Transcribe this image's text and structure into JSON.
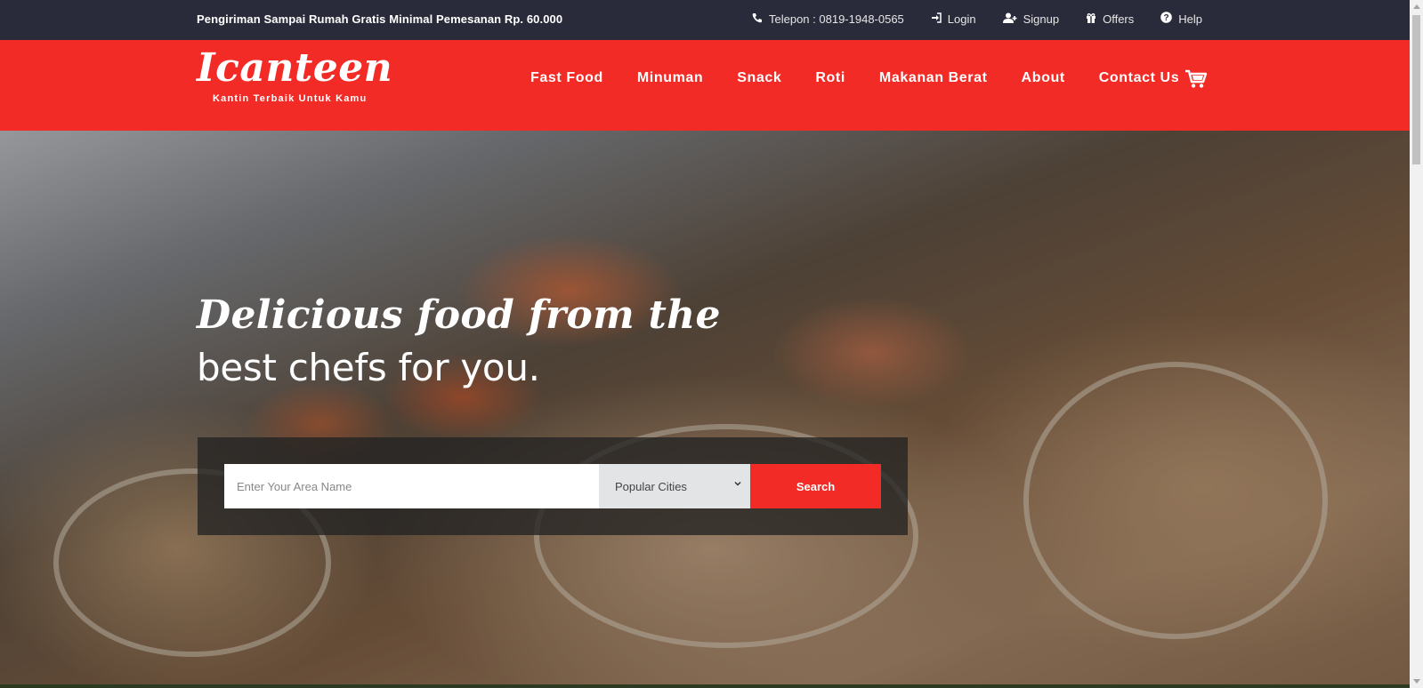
{
  "topbar": {
    "promo": "Pengiriman Sampai Rumah Gratis Minimal Pemesanan Rp. 60.000",
    "links": [
      {
        "label": "Telepon : 0819-1948-0565",
        "icon": "phone-icon"
      },
      {
        "label": "Login",
        "icon": "sign-in-icon"
      },
      {
        "label": "Signup",
        "icon": "user-plus-icon"
      },
      {
        "label": "Offers",
        "icon": "gift-icon"
      },
      {
        "label": "Help",
        "icon": "question-circle-icon"
      }
    ]
  },
  "header": {
    "logo_name": "Icanteen",
    "logo_tagline": "Kantin Terbaik Untuk Kamu",
    "nav": [
      "Fast Food",
      "Minuman",
      "Snack",
      "Roti",
      "Makanan Berat",
      "About",
      "Contact Us"
    ],
    "cart_icon": "cart-icon"
  },
  "hero": {
    "headline_line1": "Delicious food from the",
    "headline_line2": "best chefs for you.",
    "search": {
      "placeholder": "Enter Your Area Name",
      "value": "",
      "city_selected": "Popular Cities",
      "button_label": "Search"
    }
  },
  "colors": {
    "brand_red": "#f32b26",
    "topbar_bg": "#2a2b3a"
  }
}
